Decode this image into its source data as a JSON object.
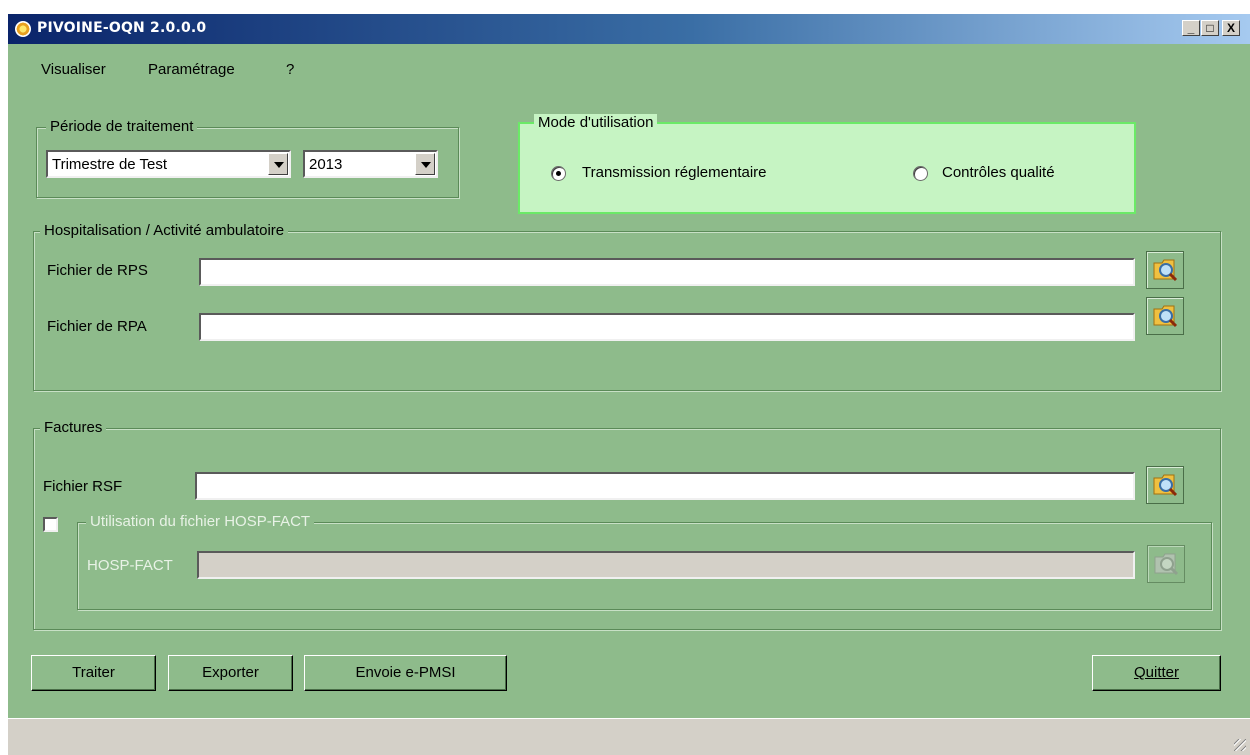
{
  "window": {
    "title": "PIVOINE-OQN 2.0.0.0",
    "minimize": "_",
    "maximize": "□",
    "close": "X"
  },
  "menu": {
    "items": [
      "Visualiser",
      "Paramétrage",
      "?"
    ]
  },
  "periode": {
    "legend": "Période de traitement",
    "trimestre": "Trimestre de Test",
    "annee": "2013"
  },
  "mode": {
    "legend": "Mode d'utilisation",
    "option1": "Transmission réglementaire",
    "option2": "Contrôles qualité",
    "selected": "Transmission réglementaire"
  },
  "hospitalisation": {
    "legend": "Hospitalisation / Activité ambulatoire",
    "rps_label": "Fichier de RPS",
    "rps_value": "",
    "rpa_label": "Fichier de RPA",
    "rpa_value": ""
  },
  "factures": {
    "legend": "Factures",
    "rsf_label": "Fichier RSF",
    "rsf_value": "",
    "hosp_legend": "Utilisation du fichier HOSP-FACT",
    "hosp_checked": false,
    "hosp_label": "HOSP-FACT",
    "hosp_value": ""
  },
  "buttons": {
    "traiter": "Traiter",
    "exporter": "Exporter",
    "envoie": "Envoie e-PMSI",
    "quitter": "Quitter"
  },
  "icons": {
    "browse": "folder-search-icon",
    "app": "pivoine-app-icon"
  }
}
